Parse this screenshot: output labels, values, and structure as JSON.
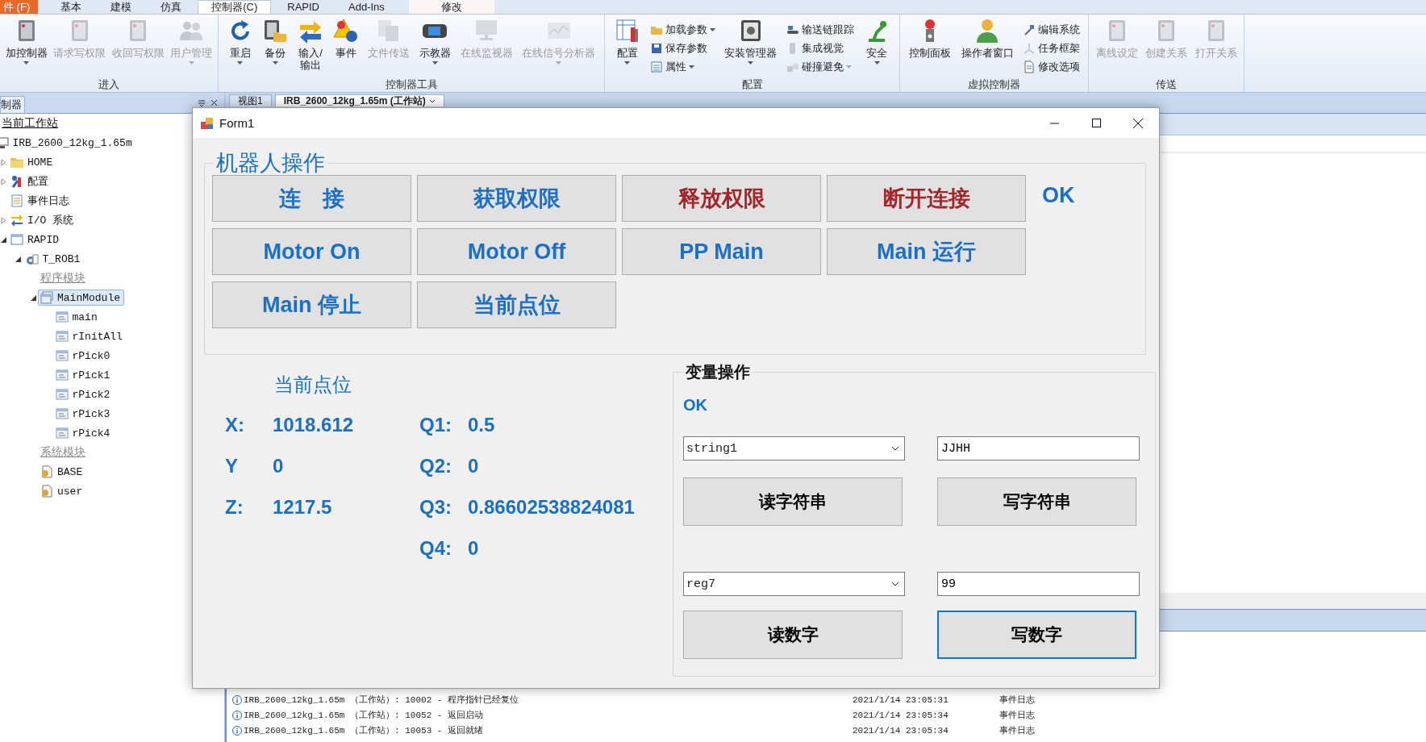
{
  "menu_tabs": [
    {
      "label": "件 (F)",
      "kind": "file",
      "selected": false
    },
    {
      "label": "基本",
      "kind": "tab",
      "selected": false
    },
    {
      "label": "建模",
      "kind": "tab",
      "selected": false
    },
    {
      "label": "仿真",
      "kind": "tab",
      "selected": false
    },
    {
      "label": "控制器(C)",
      "kind": "tab",
      "selected": true
    },
    {
      "label": "RAPID",
      "kind": "tab",
      "selected": false
    },
    {
      "label": "Add-Ins",
      "kind": "tab",
      "selected": false
    },
    {
      "label": "修改",
      "kind": "contextual",
      "selected": false
    }
  ],
  "ribbon": {
    "groups": [
      {
        "label": "进入",
        "items": [
          {
            "label": "加控制器",
            "kind": "large",
            "disabled": false,
            "dropdown": true
          },
          {
            "label": "请求写权限",
            "kind": "large",
            "disabled": true,
            "dropdown": false
          },
          {
            "label": "收回写权限",
            "kind": "large",
            "disabled": true,
            "dropdown": false
          },
          {
            "label": "用户管理",
            "kind": "large",
            "disabled": true,
            "dropdown": true
          }
        ]
      },
      {
        "label": "控制器工具",
        "items": [
          {
            "label": "重启",
            "kind": "large",
            "disabled": false,
            "dropdown": true
          },
          {
            "label": "备份",
            "kind": "large",
            "disabled": false,
            "dropdown": true
          },
          {
            "label": "输入/\n输出",
            "kind": "large",
            "disabled": false,
            "dropdown": false
          },
          {
            "label": "事件",
            "kind": "large",
            "disabled": false,
            "dropdown": false
          },
          {
            "label": "文件传送",
            "kind": "large",
            "disabled": true,
            "dropdown": false
          },
          {
            "label": "示教器",
            "kind": "large",
            "disabled": false,
            "dropdown": true
          },
          {
            "label": "在线监视器",
            "kind": "large",
            "disabled": true,
            "dropdown": false
          },
          {
            "label": "在线信号分析器",
            "kind": "large",
            "disabled": true,
            "dropdown": true
          }
        ]
      },
      {
        "label": "配置",
        "items": [
          {
            "label": "配置",
            "kind": "large",
            "disabled": false,
            "dropdown": true
          },
          {
            "label": "加载参数",
            "kind": "small",
            "disabled": false,
            "dropdown": true
          },
          {
            "label": "保存参数",
            "kind": "small",
            "disabled": false,
            "dropdown": false
          },
          {
            "label": "属性",
            "kind": "small",
            "disabled": false,
            "dropdown": true
          },
          {
            "label": "安装管理器",
            "kind": "large",
            "disabled": false,
            "dropdown": true
          },
          {
            "label": "输送链跟踪",
            "kind": "small",
            "disabled": false,
            "dropdown": false
          },
          {
            "label": "集成视觉",
            "kind": "small",
            "disabled": true,
            "dropdown": false
          },
          {
            "label": "碰撞避免",
            "kind": "small",
            "disabled": true,
            "dropdown": true
          },
          {
            "label": "安全",
            "kind": "large",
            "disabled": false,
            "dropdown": true
          }
        ]
      },
      {
        "label": "虚拟控制器",
        "items": [
          {
            "label": "控制面板",
            "kind": "large",
            "disabled": false,
            "dropdown": false
          },
          {
            "label": "操作者窗口",
            "kind": "large",
            "disabled": false,
            "dropdown": false
          },
          {
            "label": "编辑系统",
            "kind": "small",
            "disabled": false,
            "dropdown": false
          },
          {
            "label": "任务框架",
            "kind": "small",
            "disabled": true,
            "dropdown": false
          },
          {
            "label": "修改选项",
            "kind": "small",
            "disabled": false,
            "dropdown": false
          }
        ]
      },
      {
        "label": "传送",
        "items": [
          {
            "label": "离线设定",
            "kind": "large",
            "disabled": true,
            "dropdown": false
          },
          {
            "label": "创建关系",
            "kind": "large",
            "disabled": true,
            "dropdown": false
          },
          {
            "label": "打开关系",
            "kind": "large",
            "disabled": true,
            "dropdown": false
          }
        ]
      }
    ]
  },
  "left_panel": {
    "tab": "制器",
    "tree": [
      {
        "label": "当前工作站",
        "kind": "heading",
        "selected": false,
        "children": [
          {
            "label": "IRB_2600_12kg_1.65m",
            "kind": "station",
            "selected": false,
            "children": [
              {
                "label": "HOME",
                "kind": "folder",
                "expanded": false,
                "selected": false
              },
              {
                "label": "配置",
                "kind": "config",
                "expanded": false,
                "selected": false
              },
              {
                "label": "事件日志",
                "kind": "eventlog",
                "selected": false
              },
              {
                "label": "I/O 系统",
                "kind": "io",
                "expanded": false,
                "selected": false
              },
              {
                "label": "RAPID",
                "kind": "rapid",
                "expanded": true,
                "selected": false,
                "children": [
                  {
                    "label": "T_ROB1",
                    "kind": "task",
                    "expanded": true,
                    "selected": false,
                    "children": [
                      {
                        "label": "程序模块",
                        "kind": "category",
                        "selected": false,
                        "children": [
                          {
                            "label": "MainModule",
                            "kind": "module",
                            "expanded": true,
                            "selected": true,
                            "children": [
                              {
                                "label": "main",
                                "kind": "routine",
                                "selected": false
                              },
                              {
                                "label": "rInitAll",
                                "kind": "routine",
                                "selected": false
                              },
                              {
                                "label": "rPick0",
                                "kind": "routine",
                                "selected": false
                              },
                              {
                                "label": "rPick1",
                                "kind": "routine",
                                "selected": false
                              },
                              {
                                "label": "rPick2",
                                "kind": "routine",
                                "selected": false
                              },
                              {
                                "label": "rPick3",
                                "kind": "routine",
                                "selected": false
                              },
                              {
                                "label": "rPick4",
                                "kind": "routine",
                                "selected": false
                              }
                            ]
                          }
                        ]
                      },
                      {
                        "label": "系统模块",
                        "kind": "category",
                        "selected": false,
                        "children": [
                          {
                            "label": "BASE",
                            "kind": "system-module",
                            "selected": false
                          },
                          {
                            "label": "user",
                            "kind": "system-module",
                            "selected": false
                          }
                        ]
                      }
                    ]
                  }
                ]
              }
            ]
          }
        ]
      }
    ]
  },
  "doc_tabs": [
    {
      "label": "视图1",
      "selected": false
    },
    {
      "label": "IRB_2600_12kg_1.65m (工作站)",
      "selected": true
    }
  ],
  "event_log": {
    "rows": [
      {
        "text": "IRB_2600_12kg_1.65m （工作站）: 10002 - 程序指针已经复位",
        "time": "2021/1/14 23:05:31",
        "category": "事件日志"
      },
      {
        "text": "IRB_2600_12kg_1.65m （工作站）: 10052 - 返回启动",
        "time": "2021/1/14 23:05:34",
        "category": "事件日志"
      },
      {
        "text": "IRB_2600_12kg_1.65m （工作站）: 10053 - 返回就绪",
        "time": "2021/1/14 23:05:34",
        "category": "事件日志"
      }
    ]
  },
  "form": {
    "title": "Form1",
    "robot_group": {
      "title": "机器人操作",
      "status": "OK",
      "buttons": [
        {
          "label": "连　接",
          "color": "#1a6fc7"
        },
        {
          "label": "获取权限",
          "color": "#1a6fc7"
        },
        {
          "label": "释放权限",
          "color": "#a3262a"
        },
        {
          "label": "断开连接",
          "color": "#a3262a"
        },
        {
          "label": "Motor On",
          "color": "#1a6fc7"
        },
        {
          "label": "Motor Off",
          "color": "#1a6fc7"
        },
        {
          "label": "PP Main",
          "color": "#1a6fc7"
        },
        {
          "label": "Main 运行",
          "color": "#1a6fc7"
        },
        {
          "label": "Main 停止",
          "color": "#1a6fc7"
        },
        {
          "label": "当前点位",
          "color": "#1a6fc7"
        }
      ]
    },
    "position": {
      "title": "当前点位",
      "rows": [
        {
          "label": "X:",
          "value": "1018.612",
          "q_label": "Q1:",
          "q_value": "0.5"
        },
        {
          "label": "Y",
          "value": "0",
          "q_label": "Q2:",
          "q_value": "0"
        },
        {
          "label": "Z:",
          "value": "1217.5",
          "q_label": "Q3:",
          "q_value": "0.86602538824081"
        },
        {
          "q_label": "Q4:",
          "q_value": "0"
        }
      ]
    },
    "variable_group": {
      "title": "变量操作",
      "status": "OK",
      "rows": [
        {
          "variable": "string1",
          "value": "JJHH",
          "buttons": [
            {
              "label": "读字符串",
              "focused": false
            },
            {
              "label": "写字符串",
              "focused": false
            }
          ]
        },
        {
          "variable": "reg7",
          "value": "99",
          "buttons": [
            {
              "label": "读数字",
              "focused": false
            },
            {
              "label": "写数字",
              "focused": true
            }
          ]
        }
      ]
    }
  }
}
